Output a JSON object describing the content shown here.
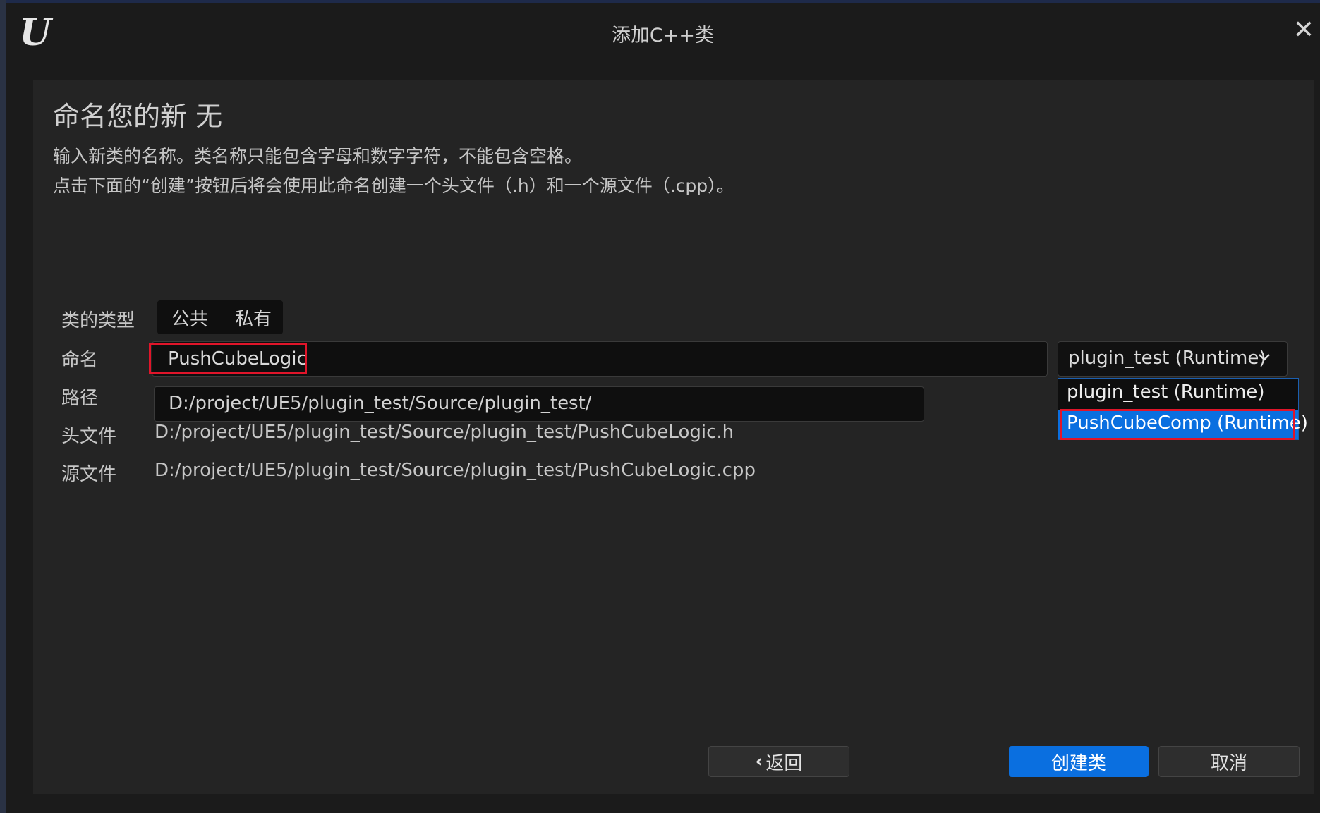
{
  "window": {
    "title": "添加C++类",
    "logo": "unreal-engine-logo",
    "logo_text": "U"
  },
  "header": {
    "heading": "命名您的新 无",
    "desc_line1": "输入新类的名称。类名称只能包含字母和数字字符，不能包含空格。",
    "desc_line2": "点击下面的“创建”按钮后将会使用此命名创建一个头文件（.h）和一个源文件（.cpp）。"
  },
  "form": {
    "class_type_label": "类的类型",
    "class_type_options": [
      "公共",
      "私有"
    ],
    "name_label": "命名",
    "name_value": "PushCubeLogic",
    "path_label": "路径",
    "path_value": "D:/project/UE5/plugin_test/Source/plugin_test/",
    "header_label": "头文件",
    "header_value": "D:/project/UE5/plugin_test/Source/plugin_test/PushCubeLogic.h",
    "source_label": "源文件",
    "source_value": "D:/project/UE5/plugin_test/Source/plugin_test/PushCubeLogic.cpp",
    "module_selected": "plugin_test (Runtime)",
    "module_options": [
      "plugin_test (Runtime)",
      "PushCubeComp (Runtime)"
    ],
    "module_highlighted": "PushCubeComp (Runtime)"
  },
  "buttons": {
    "back": "返回",
    "create": "创建类",
    "cancel": "取消"
  },
  "colors": {
    "accent": "#0a6fe0",
    "highlight_box": "#e0152a",
    "panel": "#242424",
    "background": "#1b1b1b"
  },
  "icons": {
    "close": "close-icon",
    "dropdown": "chevron-down-icon",
    "back": "chevron-left-icon"
  }
}
